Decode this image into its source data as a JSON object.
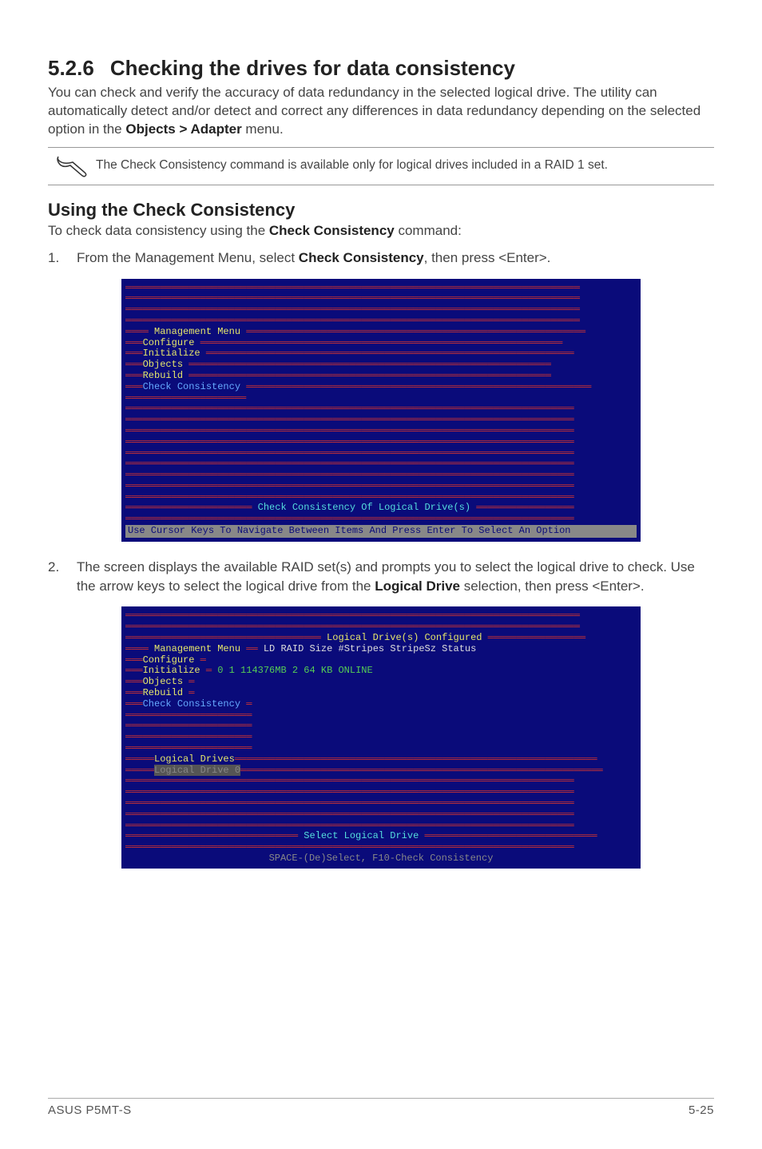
{
  "section": {
    "num": "5.2.6",
    "title": "Checking the drives for data consistency"
  },
  "intro": "You can check and verify the accuracy of data redundancy in the selected logical drive. The utility can automatically detect and/or detect and correct any differences in data redundancy depending on the selected option in the ",
  "intro_bold": "Objects > Adapter",
  "intro_tail": " menu.",
  "note": "The Check Consistency command is available only for logical drives included in a RAID 1 set.",
  "subheading": "Using the Check Consistency",
  "subintro_a": "To check data consistency using the ",
  "subintro_bold": "Check Consistency",
  "subintro_b": " command:",
  "step1": {
    "num": "1.",
    "a": "From the Management Menu, select ",
    "bold": "Check Consistency",
    "b": ", then press <Enter>."
  },
  "step2": {
    "num": "2.",
    "a": "The screen displays the available RAID set(s) and prompts you to select the logical drive to check. Use the arrow keys to select the logical drive from the ",
    "bold": "Logical Drive",
    "b": " selection, then press <Enter>."
  },
  "term1": {
    "menu_header": "Management Menu",
    "items": [
      "Configure",
      "Initialize",
      "Objects",
      "Rebuild",
      "Check Consistency"
    ],
    "status": "Check Consistency Of Logical Drive(s)",
    "footer": "Use Cursor Keys To Navigate Between Items And Press Enter To Select An Option"
  },
  "term2": {
    "header": "Logical Drive(s) Configured",
    "cols": {
      "ld": "LD",
      "raid": "RAID",
      "size": "Size",
      "stripes": "#Stripes",
      "stripesz": "StripeSz",
      "status": "Status"
    },
    "menu_header": "Management Menu",
    "items": [
      "Configure",
      "Initialize",
      "Objects",
      "Rebuild",
      "Check Consistency"
    ],
    "row": {
      "ld": "0",
      "raid": "1",
      "size": "114376MB",
      "stripes": "2",
      "stripesz": "64 KB",
      "status": "ONLINE"
    },
    "logical_drives": "Logical Drives",
    "ld_item": "Logical Drive 0",
    "status_bar": "Select Logical Drive",
    "footer": "SPACE-(De)Select,  F10-Check Consistency"
  },
  "footer": {
    "left": "ASUS P5MT-S",
    "right": "5-25"
  }
}
